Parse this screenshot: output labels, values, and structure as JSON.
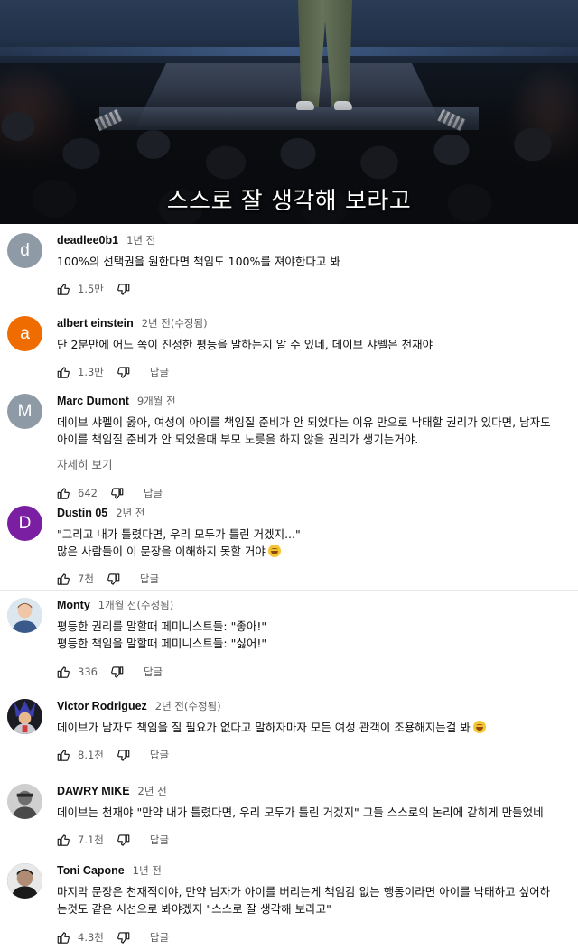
{
  "video": {
    "subtitle": "스스로 잘 생각해 보라고"
  },
  "reply_label": "답글",
  "comments": [
    {
      "author": "deadlee0b1",
      "time": "1년 전",
      "avatar_letter": "d",
      "avatar_color": "#8e9aa6",
      "text": "100%의 선택권을 원한다면 책임도 100%를 져야한다고 봐",
      "likes": "1.5만",
      "has_reply": false
    },
    {
      "author": "albert einstein",
      "time": "2년 전(수정됨)",
      "avatar_letter": "a",
      "avatar_color": "#ef6c00",
      "text": "단 2분만에 어느 쪽이 진정한 평등을 말하는지 알 수 있네, 데이브 샤펠은 천재야",
      "likes": "1.3만",
      "has_reply": true
    },
    {
      "author": "Marc Dumont",
      "time": "9개월 전",
      "avatar_letter": "M",
      "avatar_color": "#8e9aa6",
      "text": "데이브 샤펠이 옳아, 여성이 아이를 책임질 준비가 안 되었다는 이유 만으로 낙태할 권리가 있다면, 남자도\n아이를 책임질 준비가 안 되었을때 부모 노릇을 하지 않을 권리가 생기는거야.",
      "more": "자세히 보기",
      "likes": "642",
      "has_reply": true
    },
    {
      "author": "Dustin 05",
      "time": "2년 전",
      "avatar_letter": "D",
      "avatar_color": "#7b1fa2",
      "text": "\"그리고 내가 틀렸다면, 우리 모두가 틀린 거겠지...\"\n많은 사람들이 이 문장을 이해하지 못할 거야",
      "emoji": "laughing-emoji",
      "likes": "7천",
      "has_reply": true
    },
    {
      "author": "Monty",
      "time": "1개월 전(수정됨)",
      "avatar_icon": "person-photo",
      "text": "평등한 권리를 말할때 페미니스트들: \"좋아!\"\n평등한 책임을 말할때 페미니스트들: \"싫어!\"",
      "likes": "336",
      "has_reply": true
    },
    {
      "author": "Victor Rodriguez",
      "time": "2년 전(수정됨)",
      "avatar_icon": "character-photo",
      "text": "데이브가 남자도 책임을 질 필요가 없다고 말하자마자 모든 여성 관객이 조용해지는걸 봐",
      "emoji": "laughing-emoji",
      "likes": "8.1천",
      "has_reply": true
    },
    {
      "author": "DAWRY MIKE",
      "time": "2년 전",
      "avatar_icon": "person-photo",
      "text": "데이브는 천재야 \"만약 내가 틀렸다면, 우리 모두가 틀린 거겠지\" 그들 스스로의 논리에 갇히게 만들었네",
      "likes": "7.1천",
      "has_reply": true
    },
    {
      "author": "Toni Capone",
      "time": "1년 전",
      "avatar_icon": "person-photo",
      "text": "마지막 문장은 천재적이야, 만약 남자가 아이를 버리는게 책임감 없는 행동이라면 아이를 낙태하고 싶어하\n는것도 같은 시선으로 봐야겠지 \"스스로 잘 생각해 보라고\"",
      "likes": "4.3천",
      "has_reply": true
    }
  ]
}
